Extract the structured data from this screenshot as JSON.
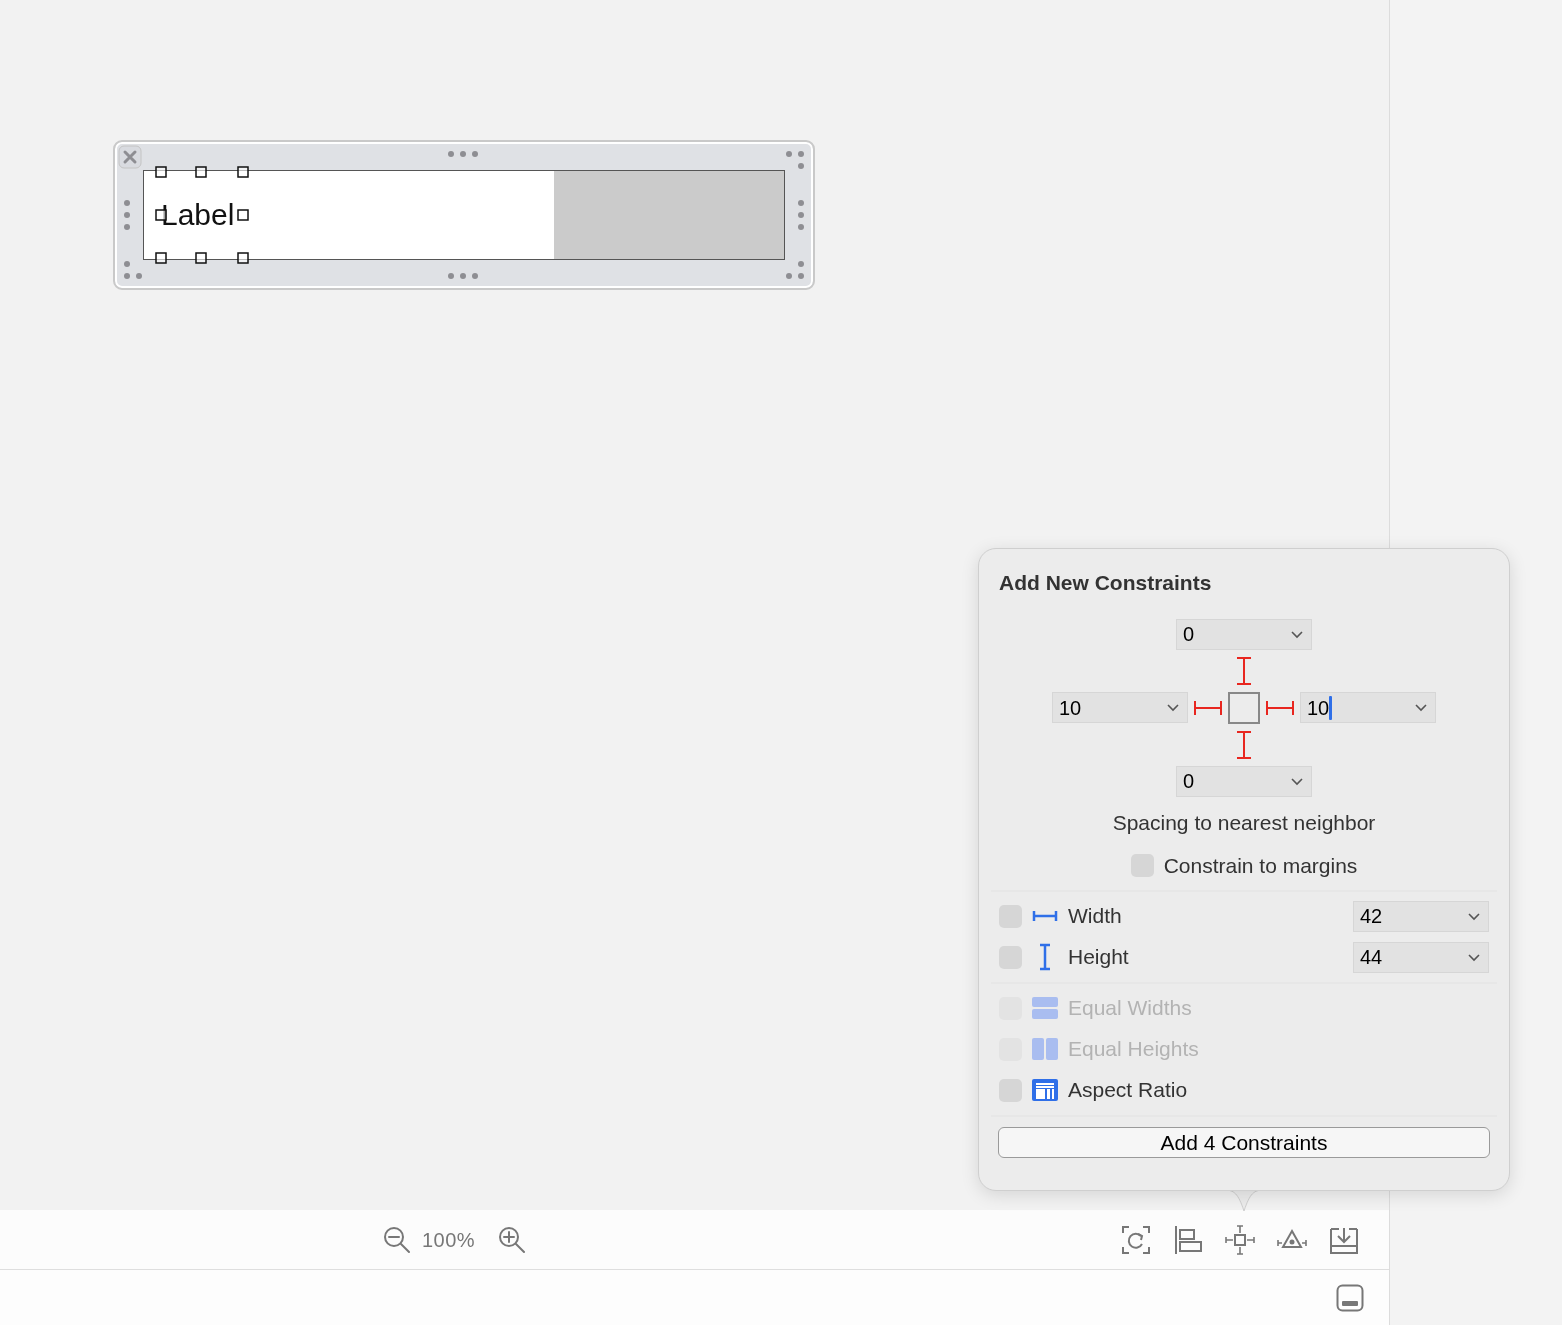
{
  "canvas": {
    "view": {
      "label": "Label"
    }
  },
  "popover": {
    "title": "Add New Constraints",
    "spacing": [
      {
        "kind": "top",
        "value": "0",
        "focused": false
      },
      {
        "kind": "left",
        "value": "10",
        "focused": false
      },
      {
        "kind": "right",
        "value": "10",
        "focused": true
      },
      {
        "kind": "bottom",
        "value": "0",
        "focused": false
      }
    ],
    "spacing_caption": "Spacing to nearest neighbor",
    "constrain_to_margins": {
      "label": "Constrain to margins",
      "checked": false
    },
    "size_rows": [
      {
        "kind": "width",
        "label": "Width",
        "checked": false,
        "value": "42"
      },
      {
        "kind": "height",
        "label": "Height",
        "checked": false,
        "value": "44"
      }
    ],
    "relation_rows": [
      {
        "kind": "equal-widths",
        "label": "Equal Widths",
        "checked": false,
        "disabled": true
      },
      {
        "kind": "equal-heights",
        "label": "Equal Heights",
        "checked": false,
        "disabled": true
      },
      {
        "kind": "aspect-ratio",
        "label": "Aspect Ratio",
        "checked": false,
        "disabled": false
      }
    ],
    "add_button": "Add 4 Constraints"
  },
  "toolbar": {
    "zoom_level": "100%"
  }
}
